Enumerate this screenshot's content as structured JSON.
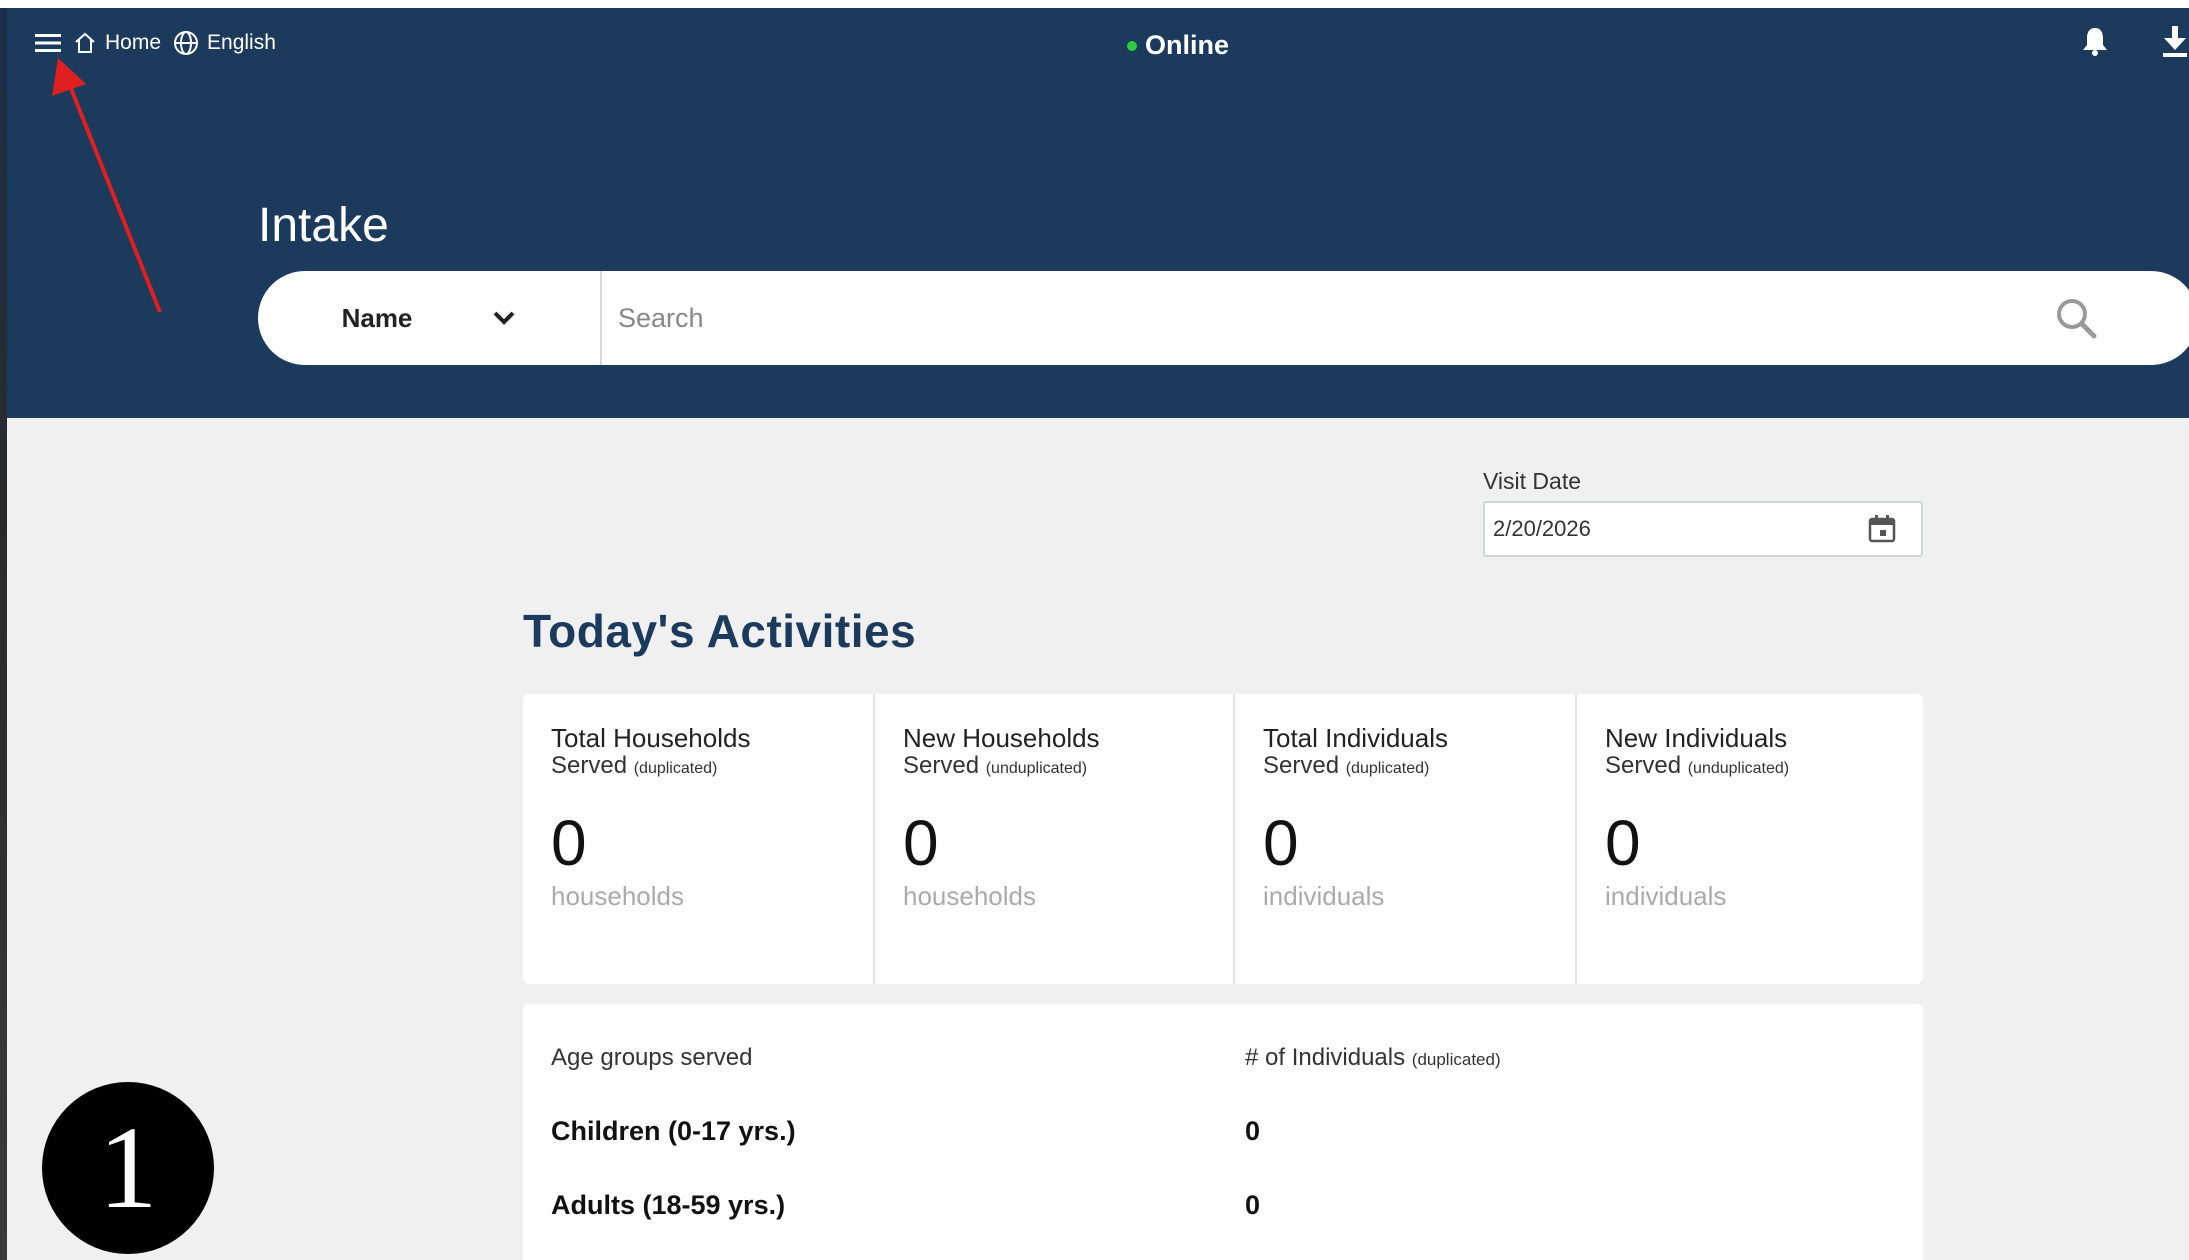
{
  "topbar": {
    "menu_icon": "hamburger-menu-icon",
    "home_label": "Home",
    "language_label": "English",
    "status_label": "Online",
    "status_color": "#2ecc40",
    "bell_icon": "bell-icon",
    "download_icon": "download-icon"
  },
  "header": {
    "title": "Intake",
    "background": "#1b3a5c"
  },
  "search": {
    "type_selected": "Name",
    "placeholder": "Search",
    "value": ""
  },
  "visit_date": {
    "label": "Visit Date",
    "value": "2/20/2026"
  },
  "activities": {
    "title": "Today's Activities",
    "stats": [
      {
        "title": "Total Households",
        "subtitle": "Served",
        "qualifier": "(duplicated)",
        "value": "0",
        "unit": "households"
      },
      {
        "title": "New Households",
        "subtitle": "Served",
        "qualifier": "(unduplicated)",
        "value": "0",
        "unit": "households"
      },
      {
        "title": "Total Individuals",
        "subtitle": "Served",
        "qualifier": "(duplicated)",
        "value": "0",
        "unit": "individuals"
      },
      {
        "title": "New Individuals",
        "subtitle": "Served",
        "qualifier": "(unduplicated)",
        "value": "0",
        "unit": "individuals"
      }
    ]
  },
  "age_groups": {
    "header_label": "Age groups served",
    "header_count": "# of Individuals",
    "header_count_qualifier": "(duplicated)",
    "rows": [
      {
        "label": "Children (0-17 yrs.)",
        "value": "0"
      },
      {
        "label": "Adults (18-59 yrs.)",
        "value": "0"
      }
    ]
  },
  "annotation": {
    "step_number": "1",
    "arrow_color": "#e02020"
  }
}
